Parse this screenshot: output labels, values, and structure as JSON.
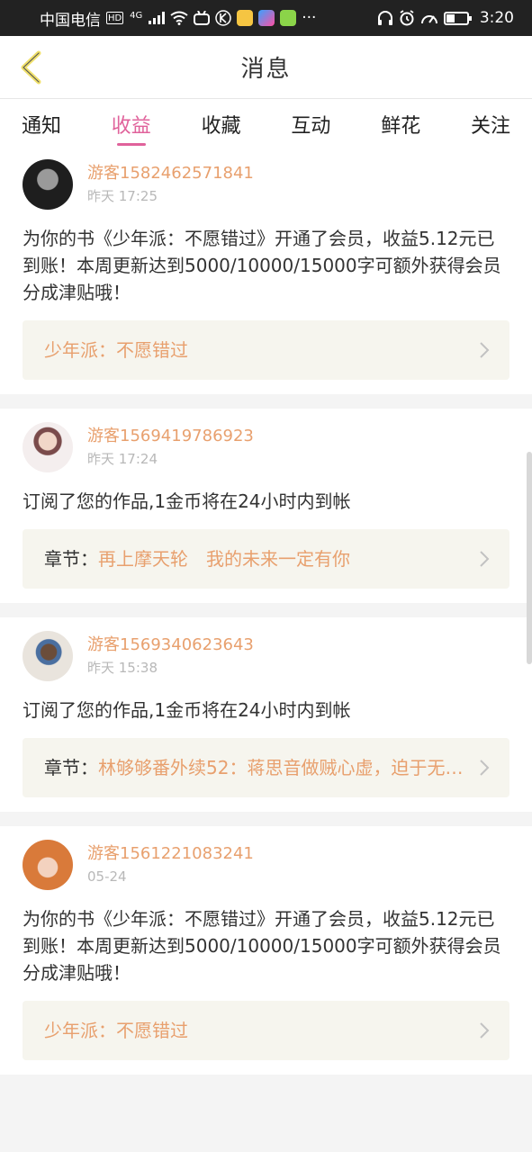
{
  "status_bar": {
    "carrier": "中国电信",
    "hd_label": "HD",
    "network": "4G",
    "more": "···",
    "time": "3:20"
  },
  "header": {
    "title": "消息"
  },
  "tabs": [
    {
      "label": "通知",
      "active": false
    },
    {
      "label": "收益",
      "active": true
    },
    {
      "label": "收藏",
      "active": false
    },
    {
      "label": "互动",
      "active": false
    },
    {
      "label": "鲜花",
      "active": false
    },
    {
      "label": "关注",
      "active": false
    }
  ],
  "messages": [
    {
      "user": "游客1582462571841",
      "time": "昨天 17:25",
      "text": "为你的书《少年派：不愿错过》开通了会员，收益5.12元已到账！本周更新达到5000/10000/15000字可额外获得会员分成津贴哦！",
      "link_label": "",
      "link_value": "少年派：不愿错过"
    },
    {
      "user": "游客1569419786923",
      "time": "昨天 17:24",
      "text": "订阅了您的作品,1金币将在24小时内到帐",
      "link_label": "章节：",
      "link_value": "再上摩天轮　我的未来一定有你"
    },
    {
      "user": "游客1569340623643",
      "time": "昨天 15:38",
      "text": "订阅了您的作品,1金币将在24小时内到帐",
      "link_label": "章节：",
      "link_value": "林够够番外续52：蒋思音做贼心虚，迫于无…"
    },
    {
      "user": "游客1561221083241",
      "time": "05-24",
      "text": "为你的书《少年派：不愿错过》开通了会员，收益5.12元已到账！本周更新达到5000/10000/15000字可额外获得会员分成津贴哦！",
      "link_label": "",
      "link_value": "少年派：不愿错过"
    }
  ],
  "colors": {
    "accent_pink": "#e0629b",
    "username_orange": "#e8a06e",
    "link_box_bg": "#f6f5ee",
    "back_arrow": "#f0e06a"
  }
}
